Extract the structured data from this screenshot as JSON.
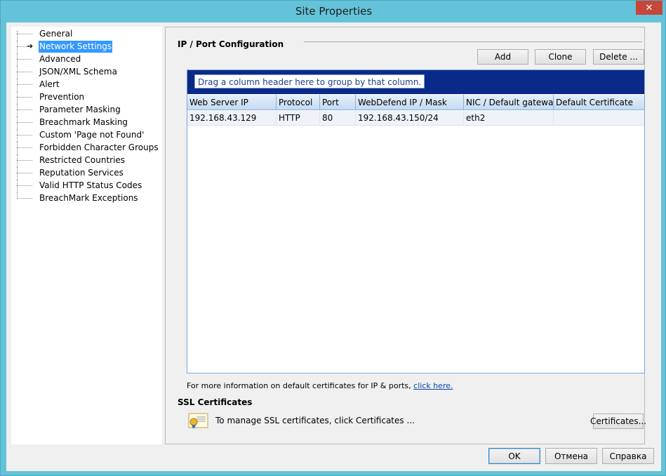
{
  "window": {
    "title": "Site Properties",
    "close_label": "✕"
  },
  "tree": {
    "items": [
      {
        "label": "General",
        "selected": false
      },
      {
        "label": "Network Settings",
        "selected": true
      },
      {
        "label": "Advanced",
        "selected": false
      },
      {
        "label": "JSON/XML Schema",
        "selected": false
      },
      {
        "label": "Alert",
        "selected": false
      },
      {
        "label": "Prevention",
        "selected": false
      },
      {
        "label": "Parameter Masking",
        "selected": false
      },
      {
        "label": "Breachmark Masking",
        "selected": false
      },
      {
        "label": "Custom 'Page not Found'",
        "selected": false
      },
      {
        "label": "Forbidden Character Groups",
        "selected": false
      },
      {
        "label": "Restricted Countries",
        "selected": false
      },
      {
        "label": "Reputation Services",
        "selected": false
      },
      {
        "label": "Valid HTTP Status Codes",
        "selected": false
      },
      {
        "label": "BreachMark Exceptions",
        "selected": false
      }
    ]
  },
  "ipport": {
    "section_title": "IP / Port Configuration",
    "add_label": "Add",
    "clone_label": "Clone",
    "delete_label": "Delete ...",
    "group_hint": "Drag a column header here to group by that column.",
    "columns": [
      "Web Server IP",
      "Protocol",
      "Port",
      "WebDefend IP / Mask",
      "NIC / Default gateway",
      "Default Certificate"
    ],
    "rows": [
      [
        "192.168.43.129",
        "HTTP",
        "80",
        "192.168.43.150/24",
        "eth2",
        ""
      ]
    ],
    "info_text": "For more information on default certificates for IP & ports,",
    "info_link": "click here."
  },
  "ssl": {
    "section_title": "SSL Certificates",
    "text": "To manage SSL certificates, click Certificates ...",
    "certificates_label": "Certificates...",
    "icon": "certificate-icon"
  },
  "dialog": {
    "ok_label": "OK",
    "cancel_label": "Отмена",
    "help_label": "Справка"
  }
}
